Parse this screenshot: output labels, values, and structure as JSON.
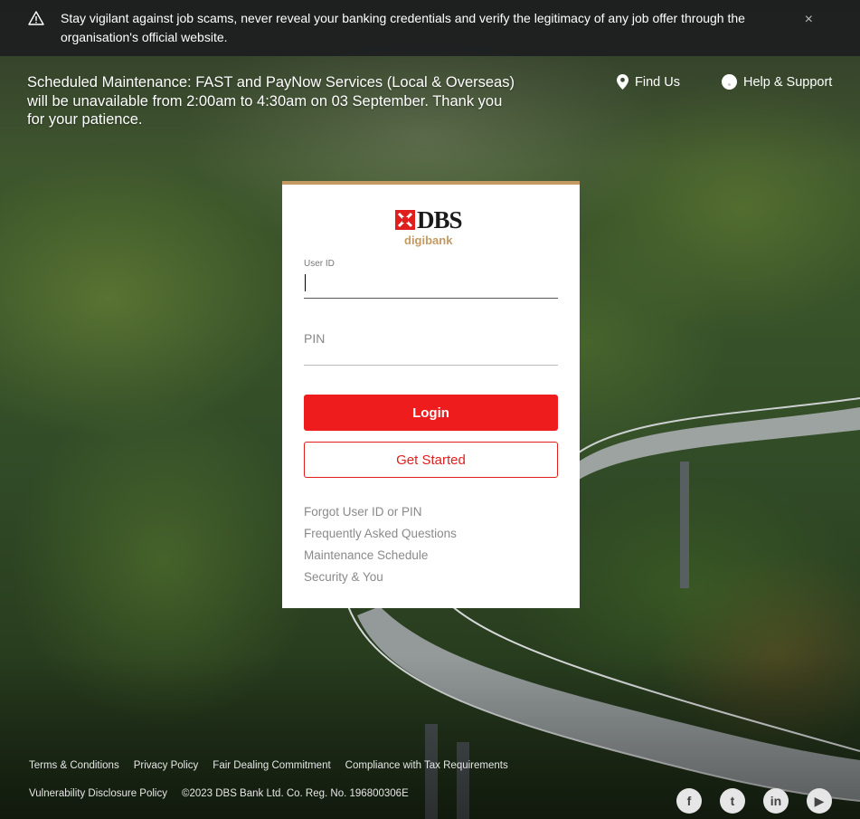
{
  "alert": {
    "message": "Stay vigilant against job scams, never reveal your banking credentials and verify the legitimacy of any job offer through the organisation's official website.",
    "close": "×"
  },
  "maintenance": {
    "text": "Scheduled Maintenance: FAST and PayNow Services (Local & Overseas) will be unavailable from 2:00am to 4:30am on 03 September. Thank you for your patience."
  },
  "topnav": {
    "find_us": "Find Us",
    "help": "Help & Support"
  },
  "login": {
    "brand": "DBS",
    "sub_brand": "digibank",
    "userid_label": "User ID",
    "userid_value": "",
    "pin_placeholder": "PIN",
    "pin_value": "",
    "login_button": "Login",
    "get_started_button": "Get Started",
    "links": [
      "Forgot User ID or PIN",
      "Frequently Asked Questions",
      "Maintenance Schedule",
      "Security & You"
    ]
  },
  "footer": {
    "row1": [
      "Terms & Conditions",
      "Privacy Policy",
      "Fair Dealing Commitment",
      "Compliance with Tax Requirements"
    ],
    "row2_link": "Vulnerability Disclosure Policy",
    "copyright": "©2023 DBS Bank Ltd. Co. Reg. No. 196800306E",
    "social": [
      {
        "name": "facebook-icon",
        "glyph": "f"
      },
      {
        "name": "twitter-icon",
        "glyph": "t"
      },
      {
        "name": "linkedin-icon",
        "glyph": "in"
      },
      {
        "name": "youtube-icon",
        "glyph": "▶"
      }
    ]
  },
  "colors": {
    "accent_red": "#ee1c1c",
    "gold": "#c39a62"
  }
}
